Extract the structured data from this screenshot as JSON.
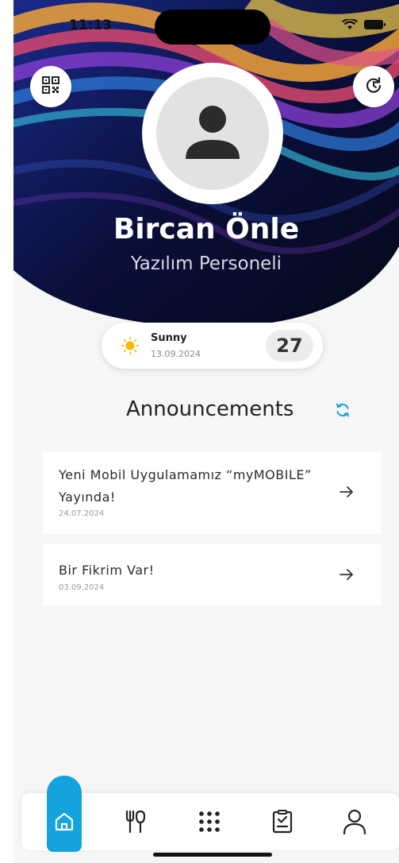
{
  "status": {
    "time": "11:13"
  },
  "profile": {
    "name": "Bircan Önle",
    "title": "Yazılım Personeli"
  },
  "weather": {
    "condition": "Sunny",
    "date": "13.09.2024",
    "temperature": "27"
  },
  "announcements": {
    "heading": "Announcements",
    "items": [
      {
        "title": "Yeni Mobil Uygulamamız “myMOBILE” Yayında!",
        "date": "24.07.2024"
      },
      {
        "title": "Bir Fikrim Var!",
        "date": "03.09.2024"
      }
    ]
  },
  "tabs": [
    "home-icon",
    "restaurant-icon",
    "apps-grid-icon",
    "checklist-icon",
    "profile-icon"
  ],
  "colors": {
    "accent": "#14a3df",
    "background": "#f6f6f6"
  }
}
